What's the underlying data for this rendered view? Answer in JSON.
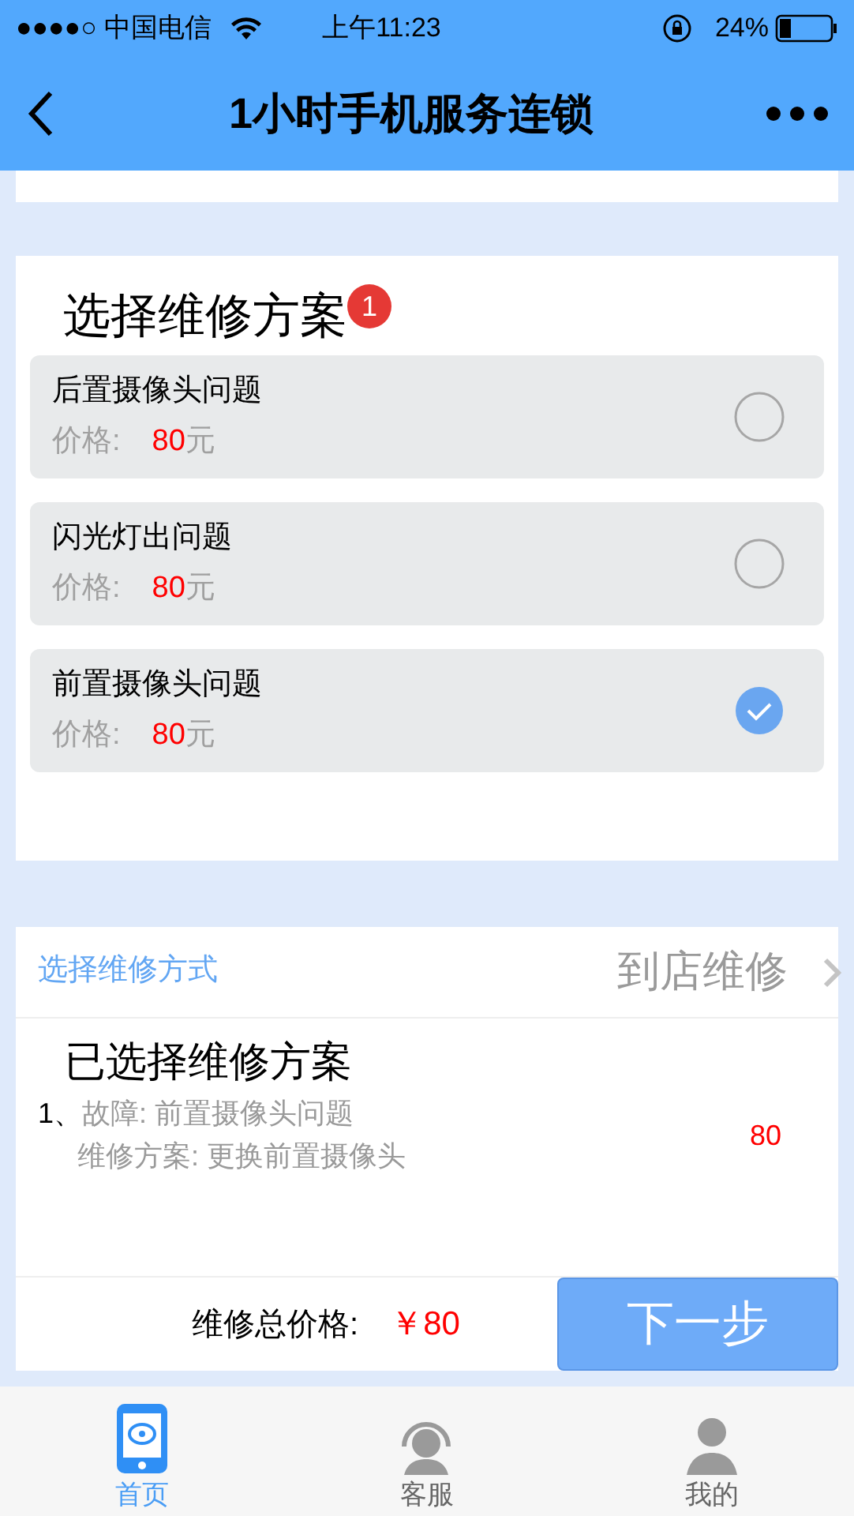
{
  "status_bar": {
    "carrier": "●●●●○ 中国电信",
    "time": "上午11:23",
    "battery": "24%"
  },
  "nav": {
    "title": "1小时手机服务连锁"
  },
  "plans": {
    "title": "选择维修方案",
    "badge": "1",
    "items": [
      {
        "name": "后置摄像头问题",
        "price_label": "价格:",
        "price": "80",
        "unit": "元",
        "selected": false
      },
      {
        "name": "闪光灯出问题",
        "price_label": "价格:",
        "price": "80",
        "unit": "元",
        "selected": false
      },
      {
        "name": "前置摄像头问题",
        "price_label": "价格:",
        "price": "80",
        "unit": "元",
        "selected": true
      }
    ]
  },
  "method": {
    "label": "选择维修方式",
    "value": "到店维修"
  },
  "chosen": {
    "title": "已选择维修方案",
    "items": [
      {
        "index": "1、",
        "fault": "故障: 前置摄像头问题",
        "plan": "维修方案: 更换前置摄像头",
        "price": "80"
      }
    ]
  },
  "footer": {
    "total_label": "维修总价格:",
    "total": "￥80",
    "next": "下一步"
  },
  "tabs": [
    {
      "label": "首页",
      "kind": "home",
      "selected": true
    },
    {
      "label": "客服",
      "kind": "service",
      "selected": false
    },
    {
      "label": "我的",
      "kind": "me",
      "selected": false
    }
  ]
}
